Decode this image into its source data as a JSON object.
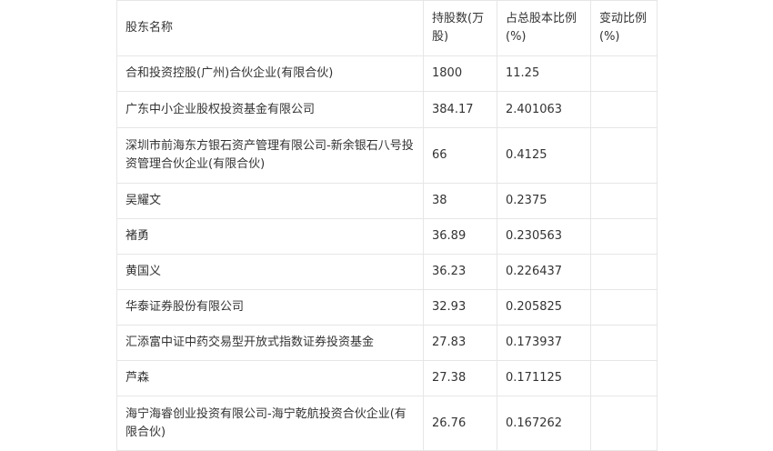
{
  "headers": [
    "股东名称",
    "持股数(万股)",
    "占总股本比例(%)",
    "变动比例(%)"
  ],
  "rows": [
    {
      "name": "合和投资控股(广州)合伙企业(有限合伙)",
      "shares": "1800",
      "ratio": "11.25",
      "change": ""
    },
    {
      "name": "广东中小企业股权投资基金有限公司",
      "shares": "384.17",
      "ratio": "2.401063",
      "change": ""
    },
    {
      "name": "深圳市前海东方银石资产管理有限公司-新余银石八号投资管理合伙企业(有限合伙)",
      "shares": "66",
      "ratio": "0.4125",
      "change": ""
    },
    {
      "name": "吴耀文",
      "shares": "38",
      "ratio": "0.2375",
      "change": ""
    },
    {
      "name": "褚勇",
      "shares": "36.89",
      "ratio": "0.230563",
      "change": ""
    },
    {
      "name": "黄国义",
      "shares": "36.23",
      "ratio": "0.226437",
      "change": ""
    },
    {
      "name": "华泰证券股份有限公司",
      "shares": "32.93",
      "ratio": "0.205825",
      "change": ""
    },
    {
      "name": "汇添富中证中药交易型开放式指数证券投资基金",
      "shares": "27.83",
      "ratio": "0.173937",
      "change": ""
    },
    {
      "name": "芦森",
      "shares": "27.38",
      "ratio": "0.171125",
      "change": ""
    },
    {
      "name": "海宁海睿创业投资有限公司-海宁乾航投资合伙企业(有限合伙)",
      "shares": "26.76",
      "ratio": "0.167262",
      "change": ""
    }
  ]
}
